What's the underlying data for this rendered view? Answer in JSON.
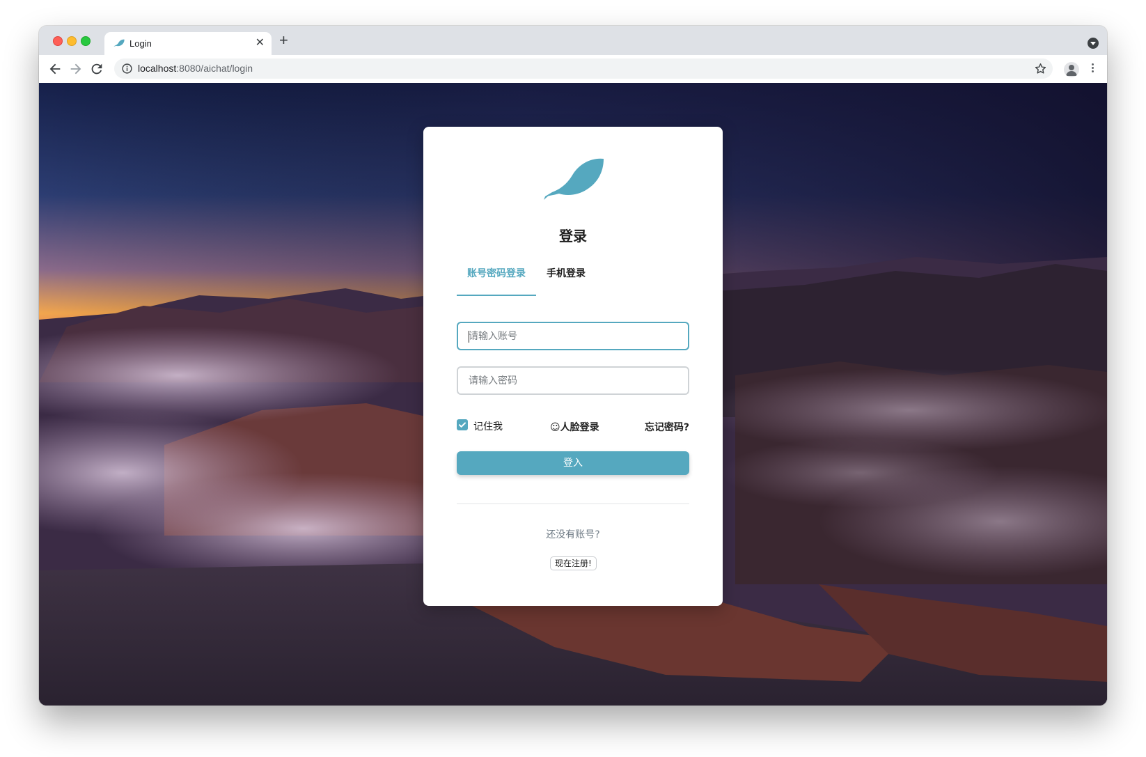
{
  "browser": {
    "tab": {
      "title": "Login",
      "close_glyph": "✕"
    },
    "new_tab_glyph": "+",
    "url": {
      "host": "localhost",
      "path": ":8080/aichat/login"
    },
    "icons": [
      "back-arrow-icon",
      "forward-arrow-icon",
      "reload-icon",
      "info-icon",
      "star-icon",
      "profile-icon",
      "kebab-menu-icon"
    ]
  },
  "login": {
    "title": "登录",
    "tabs": [
      {
        "label": "账号密码登录",
        "active": true
      },
      {
        "label": "手机登录",
        "active": false
      }
    ],
    "account_placeholder": "请输入账号",
    "password_placeholder": "请输入密码",
    "remember_label": "记住我",
    "remember_checked": true,
    "face_login_label": "☺人脸登录",
    "forgot_label": "忘记密码?",
    "submit_label": "登入",
    "no_account_text": "还没有账号?",
    "register_label": "现在注册!"
  },
  "colors": {
    "accent": "#55a8bf",
    "text": "#1f1f1f",
    "muted": "#6e7a84"
  }
}
